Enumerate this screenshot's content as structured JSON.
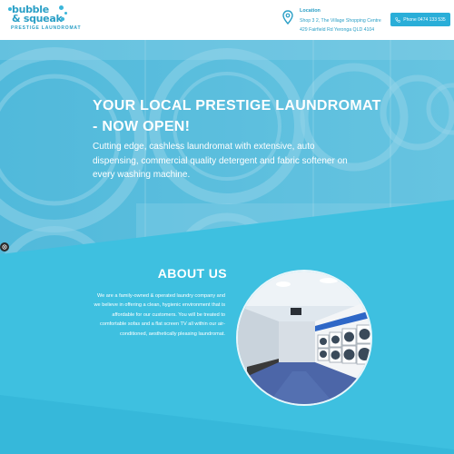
{
  "header": {
    "logo": {
      "line1": "bubble",
      "line2": "& squeak",
      "tagline": "PRESTIGE LAUNDROMAT"
    },
    "location": {
      "title": "Location",
      "line1": "Shop 3 2, The Village Shopping Centre",
      "line2": "429 Fairfield Rd Yeronga QLD 4104"
    },
    "phone_button": "Phone 0474 133 535"
  },
  "hero": {
    "title": "YOUR LOCAL PRESTIGE LAUNDROMAT - NOW OPEN!",
    "description": "Cutting edge, cashless laundromat with extensive, auto dispensing, commercial quality detergent and fabric softener on every washing machine."
  },
  "about": {
    "title": "ABOUT US",
    "text": "We are a family-owned & operated laundry company and we believe in offering a clean, hygienic environment that is affordable for our customers. You will be treated to comfortable sofas and a flat screen TV all within our air-conditioned, aesthetically pleasing laundromat."
  },
  "colors": {
    "brand": "#2a9fc6",
    "button": "#2aaed8",
    "about_bg": "#3ec0e0"
  }
}
